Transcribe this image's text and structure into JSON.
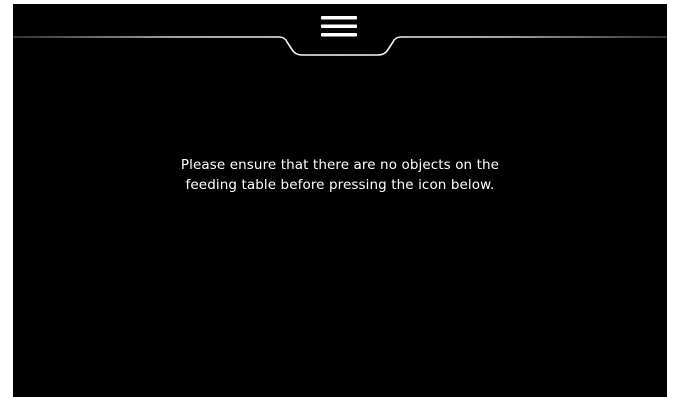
{
  "header": {
    "menu_icon": "hamburger-menu-icon"
  },
  "main": {
    "instruction_lines": [
      "Please ensure that there are no objects on the",
      "feeding table before pressing the icon below."
    ]
  },
  "colors": {
    "background": "#000000",
    "text": "#ffffff",
    "divider": "#cfcfcf"
  }
}
